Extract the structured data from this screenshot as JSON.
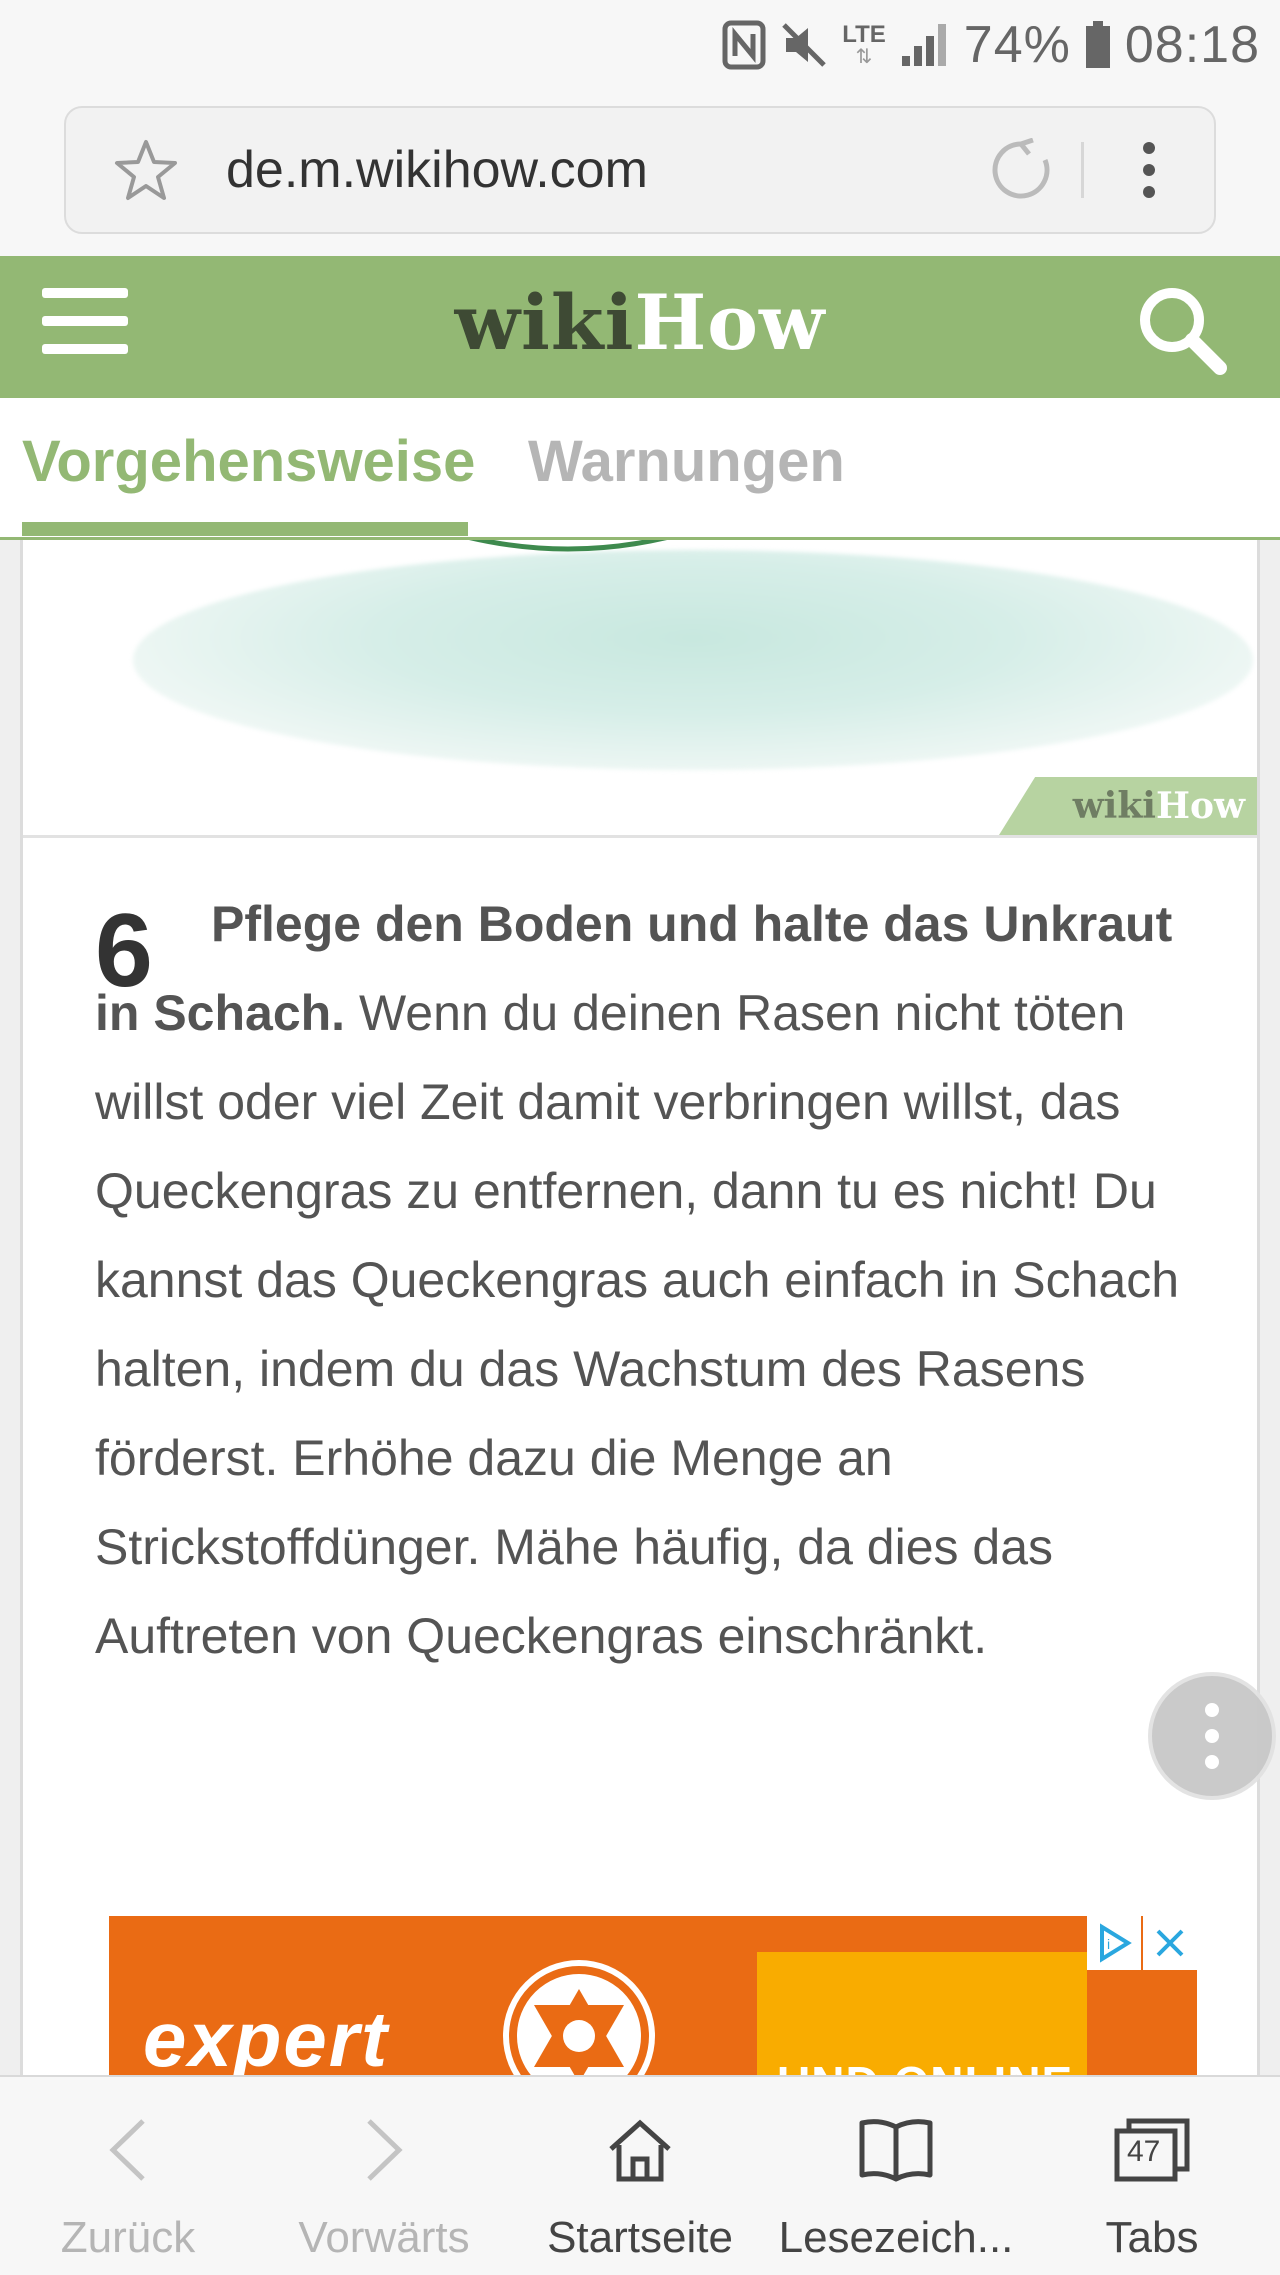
{
  "status_bar": {
    "network": "LTE",
    "battery": "74%",
    "time": "08:18"
  },
  "browser": {
    "url": "de.m.wikihow.com"
  },
  "header": {
    "logo_wiki": "wiki",
    "logo_how": "How"
  },
  "tabs": [
    {
      "label": "Vorgehensweise",
      "active": true
    },
    {
      "label": "Warnungen",
      "active": false
    }
  ],
  "image_badge": {
    "wiki": "wiki",
    "how": "How"
  },
  "step": {
    "number": "6",
    "bold": "Pflege den Boden und halte das Unkraut in Schach.",
    "text": " Wenn du deinen Rasen nicht töten willst oder viel Zeit damit verbringen willst, das Queckengras zu entfernen, dann tu es nicht! Du kannst das Queckengras auch einfach in Schach halten, indem du das Wachstum des Rasens förderst. Erhöhe dazu die Menge an Strickstoffdünger. Mähe häufig, da dies das Auftreten von Queckengras einschränkt."
  },
  "ad": {
    "brand": "expert",
    "tagline": "UND ONLINE."
  },
  "bottom_nav": [
    {
      "label": "Zurück",
      "icon": "back-icon",
      "enabled": false
    },
    {
      "label": "Vorwärts",
      "icon": "forward-icon",
      "enabled": false
    },
    {
      "label": "Startseite",
      "icon": "home-icon",
      "enabled": true
    },
    {
      "label": "Lesezeich...",
      "icon": "bookmarks-icon",
      "enabled": true
    },
    {
      "label": "Tabs",
      "icon": "tabs-icon",
      "enabled": true,
      "count": "47"
    }
  ]
}
